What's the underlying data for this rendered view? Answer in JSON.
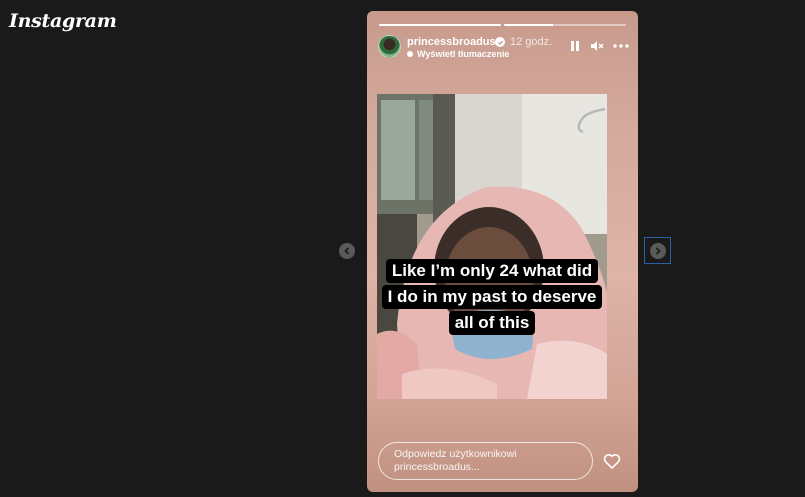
{
  "app": {
    "logo_text": "Instagram"
  },
  "story": {
    "progress": [
      1,
      0.4
    ],
    "username": "princessbroadus",
    "time_ago": "12 godz.",
    "translate_label": "Wyświetl tłumaczenie",
    "caption_lines": [
      "Like I’m only 24 what did",
      "I do in my past to deserve",
      "all of this"
    ],
    "reply_placeholder": "Odpowiedz użytkownikowi princessbroadus..."
  },
  "colors": {
    "background": "#1a1a1a",
    "story_bg": "#d4aa9c",
    "caption_bg": "#000000",
    "accent_focus": "#2d5fa8"
  },
  "icons": [
    "chevron-left-icon",
    "chevron-right-icon",
    "verified-icon",
    "pause-icon",
    "mute-icon",
    "more-icon",
    "heart-icon"
  ]
}
